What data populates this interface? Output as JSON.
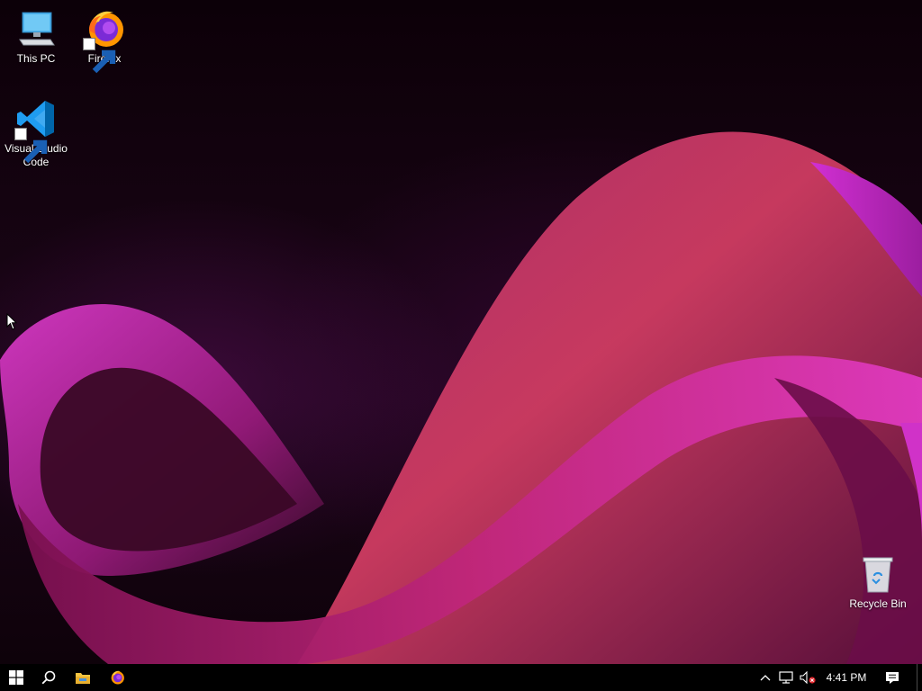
{
  "desktop": {
    "icons": [
      {
        "label": "This PC",
        "icon": "computer-icon",
        "shortcut": false
      },
      {
        "label": "Firefox",
        "icon": "firefox-icon",
        "shortcut": true
      },
      {
        "label": "Visual Studio Code",
        "icon": "vscode-icon",
        "shortcut": true
      },
      {
        "label": "Recycle Bin",
        "icon": "recycle-bin-icon",
        "shortcut": false
      }
    ]
  },
  "taskbar": {
    "start": {
      "icon": "windows-logo-icon"
    },
    "search": {
      "icon": "search-icon"
    },
    "pinned": [
      {
        "name": "File Explorer",
        "icon": "folder-icon"
      },
      {
        "name": "Firefox",
        "icon": "firefox-icon"
      }
    ],
    "tray": {
      "icons": [
        "chevron-up-icon",
        "network-icon",
        "volume-muted-icon"
      ],
      "time": "4:41 PM",
      "notification_icon": "action-center-icon"
    }
  },
  "colors": {
    "wave_magenta": "#c026c8",
    "wave_pink": "#d23a6a",
    "background": "#0e020a",
    "taskbar": "#000000"
  }
}
